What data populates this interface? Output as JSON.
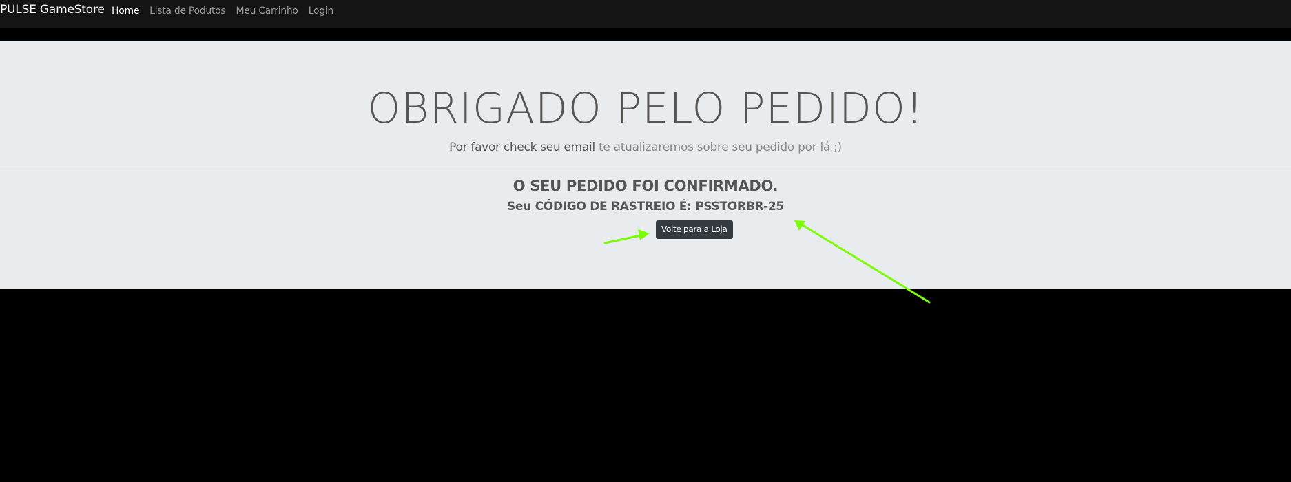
{
  "navbar": {
    "brand": "PULSE GameStore",
    "links": [
      {
        "label": "Home",
        "active": true
      },
      {
        "label": "Lista de Podutos",
        "active": false
      },
      {
        "label": "Meu Carrinho",
        "active": false
      },
      {
        "label": "Login",
        "active": false
      }
    ]
  },
  "jumbotron": {
    "title": "OBRIGADO PELO PEDIDO!",
    "lead_strong": "Por favor check seu email",
    "lead_light": " te atualizaremos sobre seu pedido por lá ;)",
    "confirmed": "O SEU PEDIDO FOI CONFIRMADO.",
    "tracking": "Seu CÓDIGO DE RASTREIO É: PSSTORBR-25",
    "back_button": "Volte para a Loja"
  },
  "colors": {
    "navbar_bg": "#141414",
    "jumbotron_bg": "#e9ecef",
    "button_bg": "#343a40",
    "annotation_arrow": "#7cfc00"
  }
}
